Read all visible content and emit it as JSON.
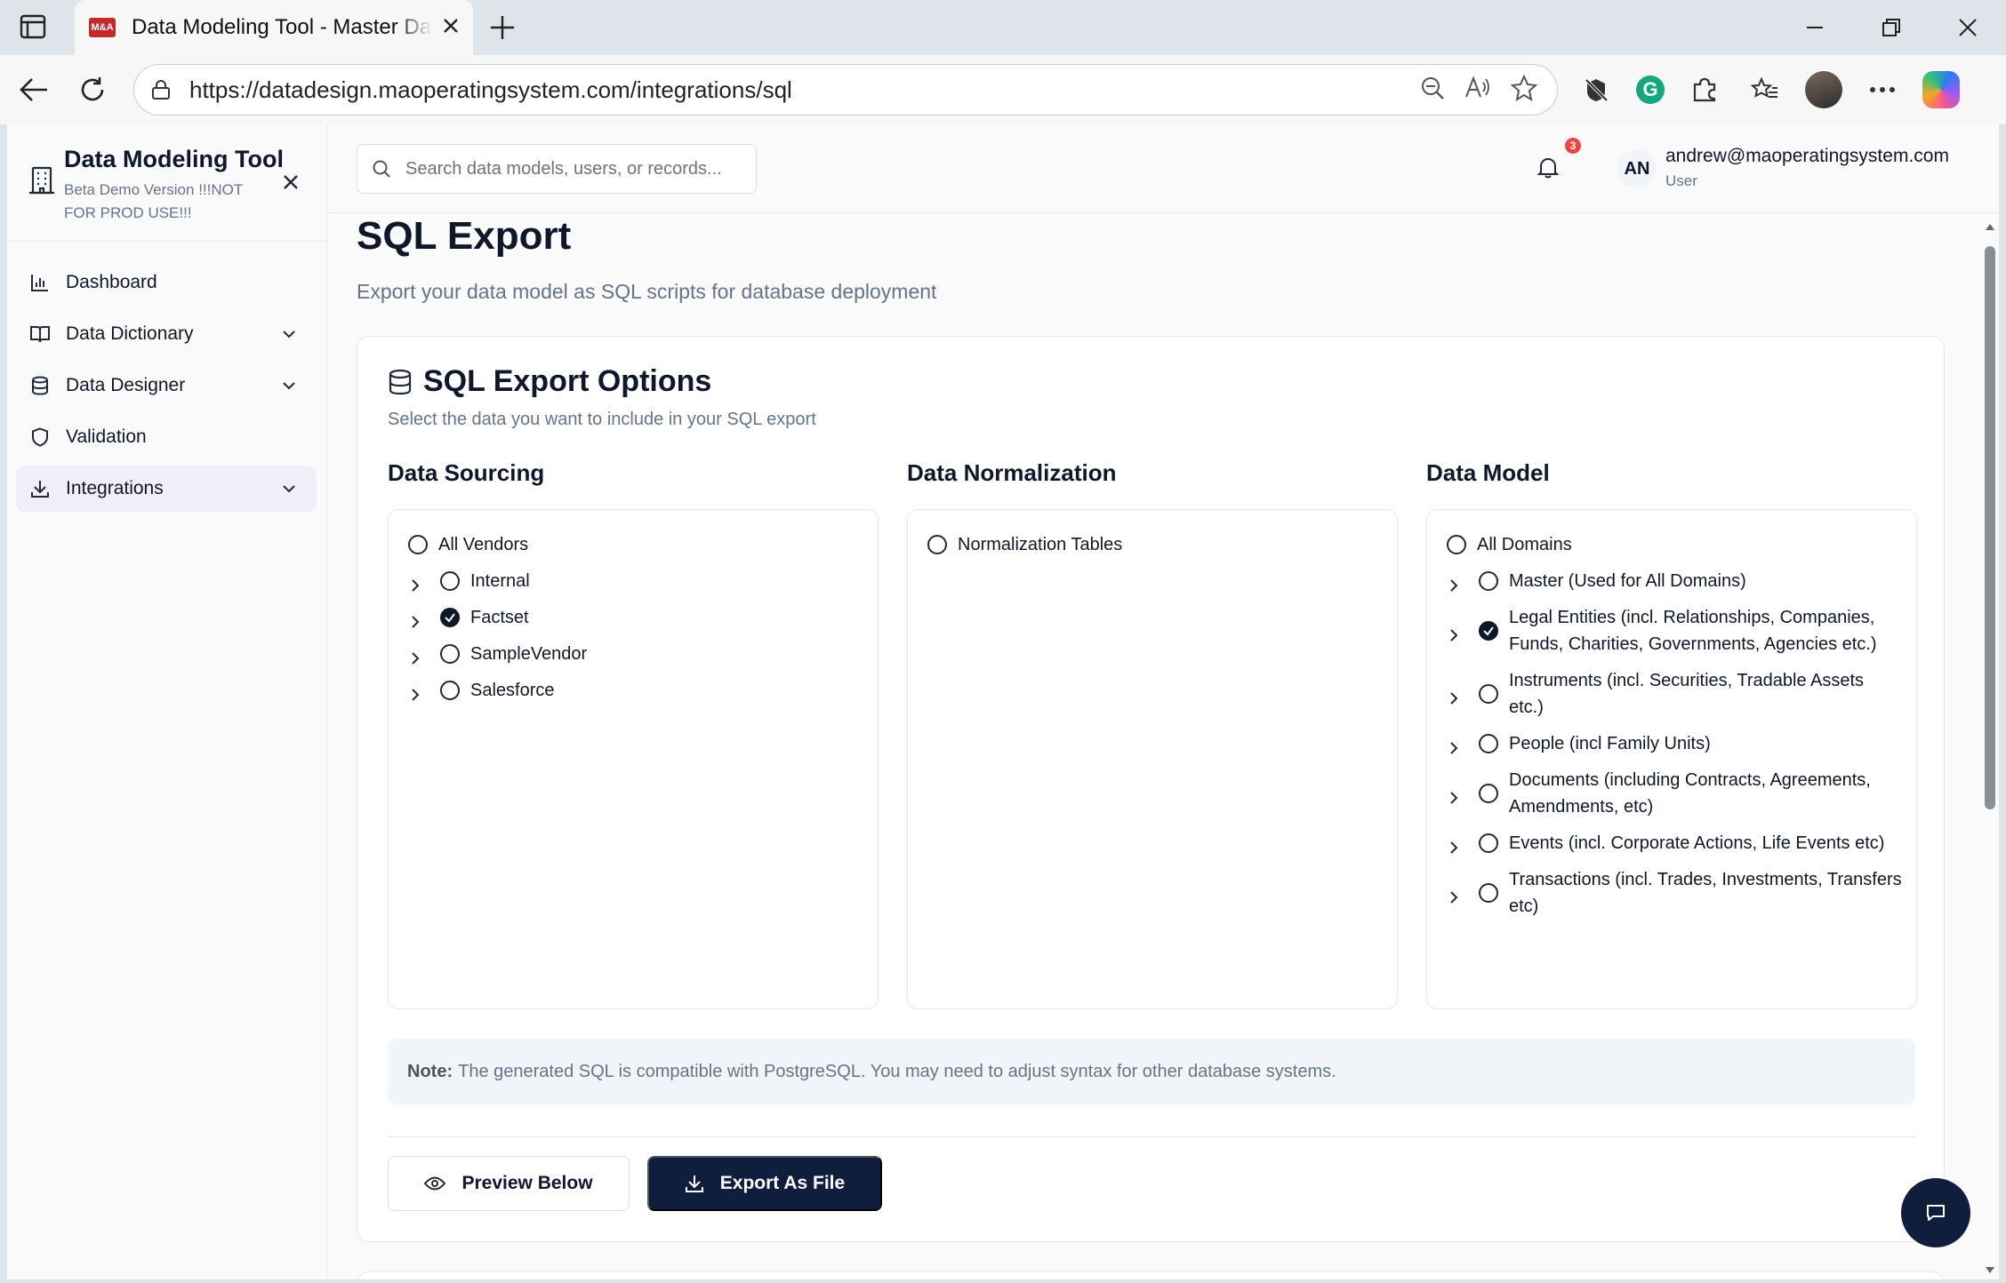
{
  "browser": {
    "tab_title": "Data Modeling Tool - Master Data",
    "tab_favicon_text": "M&A",
    "url": "https://datadesign.maoperatingsystem.com/integrations/sql"
  },
  "sidebar": {
    "app_name": "Data Modeling Tool",
    "app_subtitle": "Beta Demo Version !!!NOT FOR PROD USE!!!",
    "items": [
      {
        "label": "Dashboard",
        "icon": "bar-chart-icon",
        "expandable": false,
        "active": false
      },
      {
        "label": "Data Dictionary",
        "icon": "book-icon",
        "expandable": true,
        "active": false
      },
      {
        "label": "Data Designer",
        "icon": "database-icon",
        "expandable": true,
        "active": false
      },
      {
        "label": "Validation",
        "icon": "shield-icon",
        "expandable": false,
        "active": false
      },
      {
        "label": "Integrations",
        "icon": "download-icon",
        "expandable": true,
        "active": true
      }
    ]
  },
  "header": {
    "search_placeholder": "Search data models, users, or records...",
    "notification_count": "3",
    "user_initials": "AN",
    "user_email": "andrew@maoperatingsystem.com",
    "user_role": "User"
  },
  "page": {
    "title": "SQL Export",
    "subtitle": "Export your data model as SQL scripts for database deployment"
  },
  "card": {
    "title": "SQL Export Options",
    "subtitle": "Select the data you want to include in your SQL export",
    "columns": {
      "sourcing": {
        "title": "Data Sourcing",
        "root": {
          "label": "All Vendors",
          "checked": false
        },
        "children": [
          {
            "label": "Internal",
            "checked": false
          },
          {
            "label": "Factset",
            "checked": true
          },
          {
            "label": "SampleVendor",
            "checked": false
          },
          {
            "label": "Salesforce",
            "checked": false
          }
        ]
      },
      "normalization": {
        "title": "Data Normalization",
        "root": {
          "label": "Normalization Tables",
          "checked": false
        }
      },
      "model": {
        "title": "Data Model",
        "root": {
          "label": "All Domains",
          "checked": false
        },
        "children": [
          {
            "label": "Master (Used for All Domains)",
            "checked": false
          },
          {
            "label": "Legal Entities (incl. Relationships, Companies, Funds, Charities, Governments, Agencies etc.)",
            "checked": true
          },
          {
            "label": "Instruments (incl. Securities, Tradable Assets etc.)",
            "checked": false
          },
          {
            "label": "People (incl Family Units)",
            "checked": false
          },
          {
            "label": "Documents (including Contracts, Agreements, Amendments, etc)",
            "checked": false
          },
          {
            "label": "Events (incl. Corporate Actions, Life Events etc)",
            "checked": false
          },
          {
            "label": "Transactions (incl. Trades, Investments, Transfers etc)",
            "checked": false
          }
        ]
      }
    },
    "note_label": "Note:",
    "note_text": "The generated SQL is compatible with PostgreSQL. You may need to adjust syntax for other database systems.",
    "preview_button": "Preview Below",
    "export_button": "Export As File"
  },
  "colors": {
    "primary": "#0f1e3d",
    "active_nav_bg": "#f1eef9",
    "badge": "#ef4444",
    "muted_text": "#64748b"
  }
}
